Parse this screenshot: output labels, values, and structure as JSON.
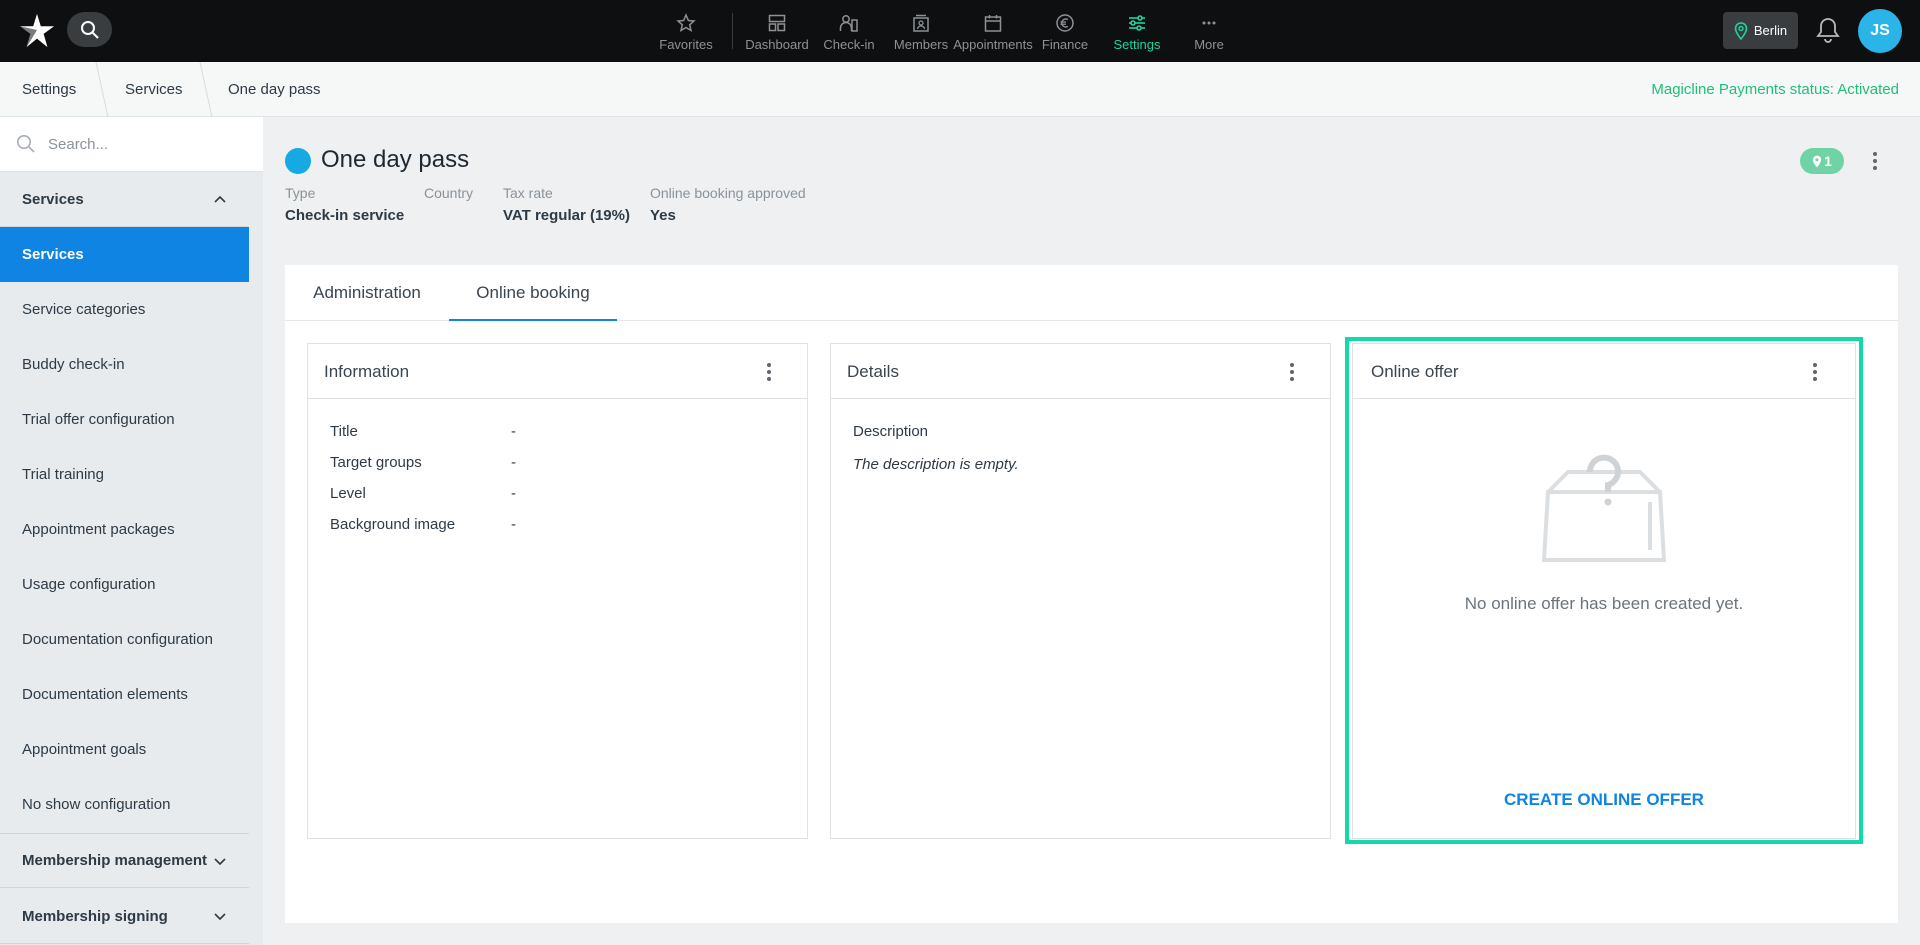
{
  "topbar": {
    "nav": [
      {
        "label": "Favorites",
        "icon": "star-icon"
      },
      {
        "label": "Dashboard",
        "icon": "dashboard-icon"
      },
      {
        "label": "Check-in",
        "icon": "check-in-icon"
      },
      {
        "label": "Members",
        "icon": "members-icon"
      },
      {
        "label": "Appointments",
        "icon": "calendar-icon"
      },
      {
        "label": "Finance",
        "icon": "euro-icon"
      },
      {
        "label": "Settings",
        "icon": "sliders-icon",
        "active": true
      },
      {
        "label": "More",
        "icon": "ellipsis-icon"
      }
    ],
    "location": "Berlin",
    "avatar_initials": "JS",
    "accent": "#1ed4a2"
  },
  "breadcrumb": {
    "items": [
      "Settings",
      "Services",
      "One day pass"
    ],
    "payment_status": "Magicline Payments status: Activated"
  },
  "sidebar": {
    "search_placeholder": "Search...",
    "group_services": "Services",
    "items": [
      "Services",
      "Service categories",
      "Buddy check-in",
      "Trial offer configuration",
      "Trial training",
      "Appointment packages",
      "Usage configuration",
      "Documentation configuration",
      "Documentation elements",
      "Appointment goals",
      "No show configuration"
    ],
    "group_membership_management": "Membership management",
    "group_membership_signing": "Membership signing"
  },
  "service": {
    "title": "One day pass",
    "dot_color": "#17a9e1",
    "meta": [
      {
        "label": "Type",
        "value": "Check-in service"
      },
      {
        "label": "Country",
        "value": ""
      },
      {
        "label": "Tax rate",
        "value": "VAT regular (19%)"
      },
      {
        "label": "Online booking approved",
        "value": "Yes"
      }
    ],
    "location_count": "1"
  },
  "tabs": [
    "Administration",
    "Online booking"
  ],
  "cards": {
    "information": {
      "title": "Information",
      "rows": [
        {
          "label": "Title",
          "value": "-"
        },
        {
          "label": "Target groups",
          "value": "-"
        },
        {
          "label": "Level",
          "value": "-"
        },
        {
          "label": "Background image",
          "value": "-"
        }
      ]
    },
    "details": {
      "title": "Details",
      "description_label": "Description",
      "description_empty": "The description is empty."
    },
    "online_offer": {
      "title": "Online offer",
      "empty_message": "No online offer has been created yet.",
      "create_label": "CREATE ONLINE OFFER"
    }
  }
}
